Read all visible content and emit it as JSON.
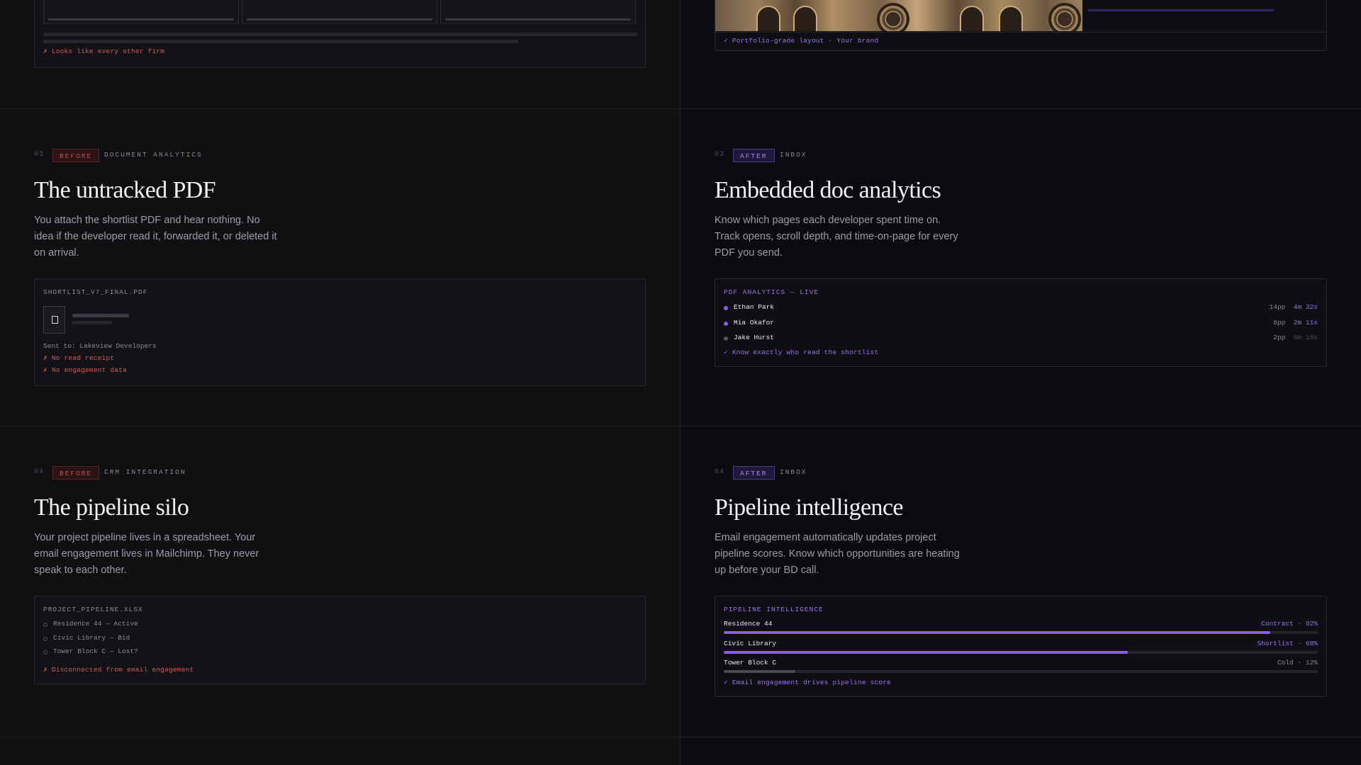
{
  "top": {
    "left_error": "✗ Looks like every other firm",
    "right_ok": "✓ Portfolio-grade layout · Your brand"
  },
  "sections": [
    {
      "before": {
        "num": "03",
        "badge": "BEFORE",
        "label": "DOCUMENT ANALYTICS",
        "title": "The untracked PDF",
        "desc": "You attach the shortlist PDF and hear nothing. No idea if the developer read it, forwarded it, or deleted it on arrival.",
        "card": {
          "file": "SHORTLIST_V7_FINAL.PDF",
          "sent": "Sent to: Lakeview Developers",
          "errors": [
            "✗ No read receipt",
            "✗ No engagement data"
          ]
        }
      },
      "after": {
        "num": "03",
        "badge": "AFTER",
        "label": "INBOX",
        "title": "Embedded doc analytics",
        "desc": "Know which pages each developer spent time on. Track opens, scroll depth, and time-on-page for every PDF you send.",
        "card": {
          "head": "PDF ANALYTICS — LIVE",
          "rows": [
            {
              "name": "Ethan Park",
              "pages": "14pp",
              "time": "4m 32s",
              "active": true
            },
            {
              "name": "Mia Okafor",
              "pages": "6pp",
              "time": "2m 11s",
              "active": true
            },
            {
              "name": "Jake Hurst",
              "pages": "2pp",
              "time": "0m 18s",
              "active": false
            }
          ],
          "ok": "✓ Know exactly who read the shortlist"
        }
      }
    },
    {
      "before": {
        "num": "04",
        "badge": "BEFORE",
        "label": "CRM INTEGRATION",
        "title": "The pipeline silo",
        "desc": "Your project pipeline lives in a spreadsheet. Your email engagement lives in Mailchimp. They never speak to each other.",
        "card": {
          "file": "PROJECT_PIPELINE.XLSX",
          "rows": [
            "Residence 44 — Active",
            "Civic Library — Bid",
            "Tower Block C — Lost?"
          ],
          "error": "✗ Disconnected from email engagement"
        }
      },
      "after": {
        "num": "04",
        "badge": "AFTER",
        "label": "INBOX",
        "title": "Pipeline intelligence",
        "desc": "Email engagement automatically updates project pipeline scores. Know which opportunities are heating up before your BD call.",
        "card": {
          "head": "PIPELINE INTELLIGENCE",
          "rows": [
            {
              "name": "Residence 44",
              "status": "Contract · 92%",
              "value": 0.92,
              "hot": true
            },
            {
              "name": "Civic Library",
              "status": "Shortlist · 68%",
              "value": 0.68,
              "hot": true
            },
            {
              "name": "Tower Block C",
              "status": "Cold · 12%",
              "value": 0.12,
              "hot": false
            }
          ],
          "ok": "✓ Email engagement drives pipeline score"
        }
      }
    }
  ],
  "colors": {
    "accent": "#8a5cf0",
    "error": "#d65a5a",
    "muted": "#8a8a92"
  }
}
